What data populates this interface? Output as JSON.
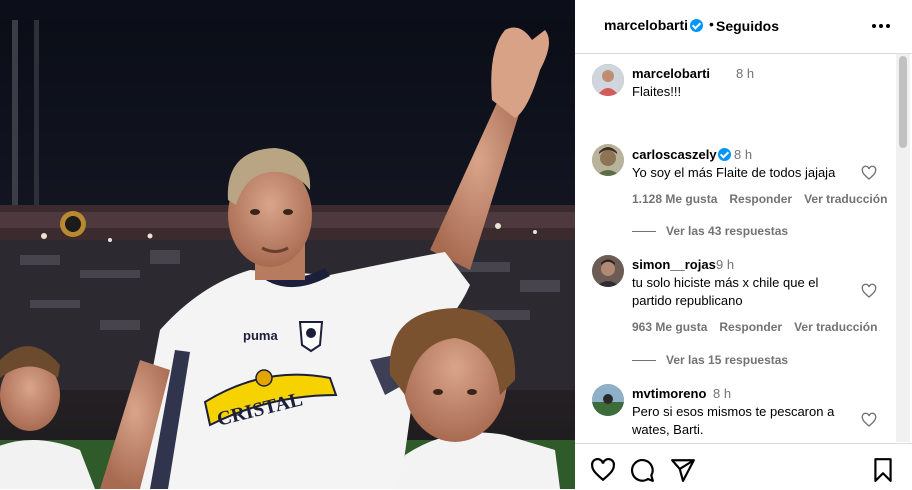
{
  "post": {
    "author": "marcelobarti",
    "follow_status": "Seguidos",
    "separator": "•",
    "caption": "Flaites!!!",
    "caption_time": "8 h"
  },
  "photo": {
    "jersey_sponsor": "CRISTAL",
    "jersey_brand": "puma"
  },
  "comments": [
    {
      "user": "carloscaszely",
      "verified": true,
      "time": "8 h",
      "text": "Yo soy el más Flaite de todos jajaja",
      "likes": "1.128 Me gusta",
      "reply": "Responder",
      "translate": "Ver traducción",
      "replies": "Ver las 43 respuestas"
    },
    {
      "user": "simon__rojas",
      "verified": false,
      "time": "9 h",
      "text": "tu solo hiciste más x chile que el\npartido republicano",
      "likes": "963 Me gusta",
      "reply": "Responder",
      "translate": "Ver traducción",
      "replies": "Ver las 15 respuestas"
    },
    {
      "user": "mvtimoreno",
      "verified": false,
      "time": "8 h",
      "text": "Pero si esos mismos te pescaron a\nwates, Barti."
    }
  ],
  "icons": {
    "like": "heart-icon",
    "comment": "comment-icon",
    "share": "send-icon",
    "save": "bookmark-icon",
    "more": "more-options-icon",
    "verified": "verified-badge-icon"
  },
  "colors": {
    "verified": "#0095f6",
    "secondary_text": "#737373",
    "divider": "#dbdbdb"
  }
}
